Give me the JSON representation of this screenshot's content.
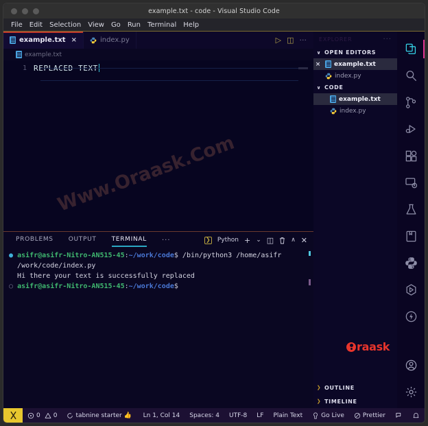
{
  "window": {
    "title": "example.txt - code - Visual Studio Code",
    "traffic_lights": [
      "close",
      "minimize",
      "maximize"
    ]
  },
  "menubar": {
    "items": [
      "File",
      "Edit",
      "Selection",
      "View",
      "Go",
      "Run",
      "Terminal",
      "Help"
    ]
  },
  "tabs": [
    {
      "label": "example.txt",
      "icon": "text-file-icon",
      "active": true,
      "close": "×"
    },
    {
      "label": "index.py",
      "icon": "python-file-icon",
      "active": false
    }
  ],
  "tab_actions": {
    "run": "▷",
    "split_editor": "◫",
    "more": "···"
  },
  "breadcrumb": {
    "file": "example.txt"
  },
  "editor": {
    "line_number": "1",
    "line_text": "REPLACED TEXT",
    "watermark": "Www.Oraask.Com"
  },
  "panel": {
    "tabs": [
      {
        "label": "PROBLEMS",
        "active": false
      },
      {
        "label": "OUTPUT",
        "active": false
      },
      {
        "label": "TERMINAL",
        "active": true
      }
    ],
    "more": "···",
    "shell_badge": "❯",
    "shell_name": "Python",
    "actions": {
      "new_terminal": "+",
      "dropdown": "⌄",
      "split": "◫",
      "kill": "Ὕ1",
      "maximize": "∧",
      "close": "✕"
    }
  },
  "terminal": {
    "lines": [
      {
        "bullet": "●",
        "bullet_style": "filled",
        "user": "asifr@asifr-Nitro-AN515-45",
        "colon": ":",
        "path": "~/work/code",
        "dollar": "$",
        "command": " /bin/python3 /home/asifr"
      },
      {
        "continuation": "/work/code/index.py"
      },
      {
        "output": "Hi there your text is successfully replaced"
      },
      {
        "bullet": "○",
        "bullet_style": "hollow",
        "user": "asifr@asifr-Nitro-AN515-45",
        "colon": ":",
        "path": "~/work/code",
        "dollar": "$",
        "command": ""
      }
    ]
  },
  "sidebar": {
    "title": "EXPLORER",
    "title_more": "···",
    "sections": [
      {
        "name": "OPEN EDITORS",
        "chevron": "∨",
        "rows": [
          {
            "label": "example.txt",
            "icon": "text-file-icon",
            "close": "×",
            "selected": true
          },
          {
            "label": "index.py",
            "icon": "python-file-icon",
            "selected": false
          }
        ]
      },
      {
        "name": "CODE",
        "chevron": "∨",
        "rows": [
          {
            "label": "example.txt",
            "icon": "text-file-icon",
            "selected": true
          },
          {
            "label": "index.py",
            "icon": "python-file-icon",
            "selected": false
          }
        ]
      }
    ],
    "brand": {
      "text": "raask"
    },
    "footer": [
      {
        "name": "OUTLINE",
        "chevron": "❯"
      },
      {
        "name": "TIMELINE",
        "chevron": "❯"
      }
    ]
  },
  "activity_bar": {
    "top": [
      {
        "name": "explorer-icon",
        "active": true
      },
      {
        "name": "search-icon",
        "active": false
      },
      {
        "name": "source-control-icon",
        "active": false
      },
      {
        "name": "run-and-debug-icon",
        "active": false
      },
      {
        "name": "extensions-icon",
        "active": false
      },
      {
        "name": "remote-explorer-icon",
        "active": false
      },
      {
        "name": "testing-icon",
        "active": false
      },
      {
        "name": "notebook-icon",
        "active": false
      },
      {
        "name": "python-icon",
        "active": false
      },
      {
        "name": "docker-icon",
        "active": false
      },
      {
        "name": "thunder-client-icon",
        "active": false
      }
    ],
    "bottom": [
      {
        "name": "account-icon",
        "active": false
      },
      {
        "name": "settings-gear-icon",
        "active": false
      }
    ]
  },
  "status_bar": {
    "remote_icon": "remote-window-icon",
    "errors": "0",
    "warnings": "0",
    "tabnine": "tabnine starter",
    "tabnine_emoji": "👍",
    "position": "Ln 1, Col 14",
    "indent": "Spaces: 4",
    "encoding": "UTF-8",
    "eol": "LF",
    "language": "Plain Text",
    "go_live": "Go Live",
    "prettier": "Prettier",
    "feedback_icon": "feedback-icon",
    "bell_icon": "notifications-bell-icon"
  }
}
